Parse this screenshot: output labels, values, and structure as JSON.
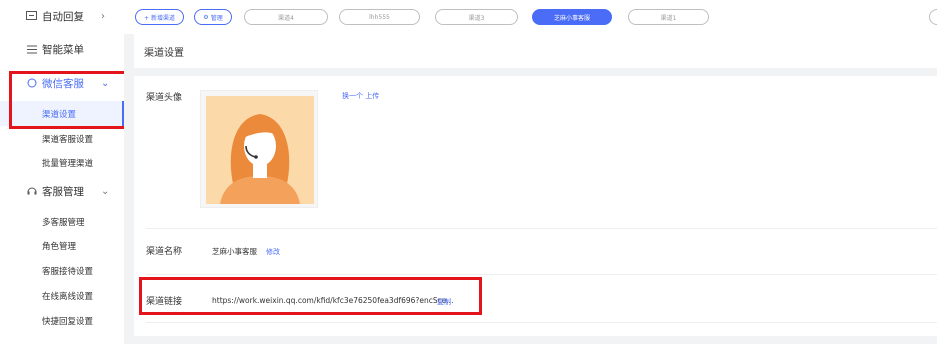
{
  "sidebar": {
    "auto_reply": "自动回复",
    "smart_menu": "智能菜单",
    "wecom_service": "微信客服",
    "wecom_subs": [
      "渠道设置",
      "渠道客服设置",
      "批量管理渠道"
    ],
    "cs_manage": "客服管理",
    "cs_subs": [
      "多客服管理",
      "角色管理",
      "客服接待设置",
      "在线离线设置",
      "快捷回复设置"
    ],
    "arrow_right": "›",
    "arrow_down": "⌄"
  },
  "tabs": {
    "new_channel": "+ 新增渠道",
    "manage": "管理",
    "items": [
      "渠道4",
      "lhh555",
      "渠道3",
      "芝麻小事客服",
      "渠道1"
    ]
  },
  "main": {
    "title": "渠道设置",
    "avatar_label": "渠道头像",
    "avatar_actions": "换一个  上传",
    "name_label": "渠道名称",
    "name_value": "芝麻小事客服",
    "name_edit": "修改",
    "link_label": "渠道链接",
    "link_value": "https://work.weixin.qq.com/kfid/kfc3e76250fea3df696?encSce...",
    "link_copy": "复制"
  },
  "colors": {
    "accent": "#4a6cf7",
    "highlight": "#e4141c"
  }
}
